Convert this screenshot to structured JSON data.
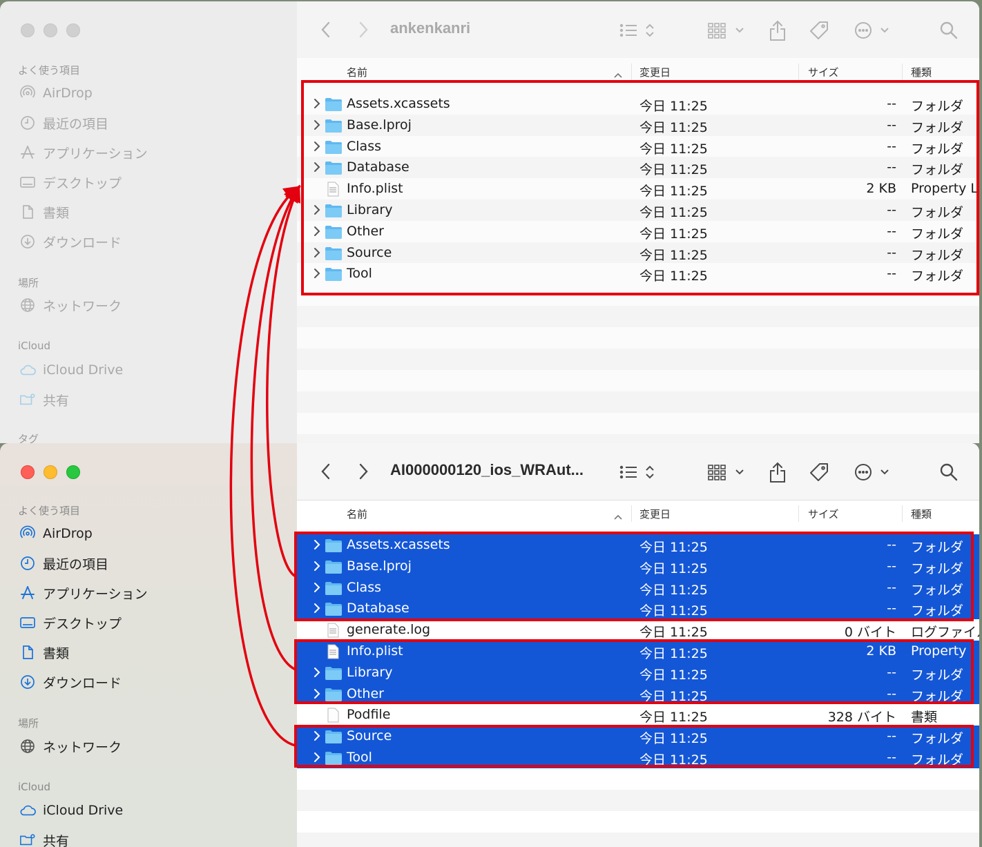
{
  "sidebar": {
    "favorites_header": "よく使う項目",
    "places_header": "場所",
    "icloud_header": "iCloud",
    "tags_header": "タグ",
    "items": [
      {
        "label": "AirDrop",
        "icon": "airdrop-icon"
      },
      {
        "label": "最近の項目",
        "icon": "clock-icon"
      },
      {
        "label": "アプリケーション",
        "icon": "applications-icon"
      },
      {
        "label": "デスクトップ",
        "icon": "desktop-icon"
      },
      {
        "label": "書類",
        "icon": "document-icon"
      },
      {
        "label": "ダウンロード",
        "icon": "download-icon"
      }
    ],
    "network": {
      "label": "ネットワーク",
      "icon": "globe-icon"
    },
    "icloud_drive": {
      "label": "iCloud Drive",
      "icon": "cloud-icon"
    },
    "shared": {
      "label": "共有",
      "icon": "shared-folder-icon"
    }
  },
  "columns": {
    "name": "名前",
    "modified": "変更日",
    "size": "サイズ",
    "kind": "種類"
  },
  "window_top": {
    "title": "ankenkanri",
    "files": [
      {
        "name": "Assets.xcassets",
        "date": "今日 11:25",
        "size": "--",
        "kind": "フォルダ",
        "type": "folder"
      },
      {
        "name": "Base.lproj",
        "date": "今日 11:25",
        "size": "--",
        "kind": "フォルダ",
        "type": "folder"
      },
      {
        "name": "Class",
        "date": "今日 11:25",
        "size": "--",
        "kind": "フォルダ",
        "type": "folder"
      },
      {
        "name": "Database",
        "date": "今日 11:25",
        "size": "--",
        "kind": "フォルダ",
        "type": "folder"
      },
      {
        "name": "Info.plist",
        "date": "今日 11:25",
        "size": "2 KB",
        "kind": "Property L",
        "type": "plist"
      },
      {
        "name": "Library",
        "date": "今日 11:25",
        "size": "--",
        "kind": "フォルダ",
        "type": "folder"
      },
      {
        "name": "Other",
        "date": "今日 11:25",
        "size": "--",
        "kind": "フォルダ",
        "type": "folder"
      },
      {
        "name": "Source",
        "date": "今日 11:25",
        "size": "--",
        "kind": "フォルダ",
        "type": "folder"
      },
      {
        "name": "Tool",
        "date": "今日 11:25",
        "size": "--",
        "kind": "フォルダ",
        "type": "folder"
      }
    ]
  },
  "window_bottom": {
    "title": "AI000000120_ios_WRAut...",
    "files": [
      {
        "name": "Assets.xcassets",
        "date": "今日 11:25",
        "size": "--",
        "kind": "フォルダ",
        "type": "folder",
        "selected": true
      },
      {
        "name": "Base.lproj",
        "date": "今日 11:25",
        "size": "--",
        "kind": "フォルダ",
        "type": "folder",
        "selected": true
      },
      {
        "name": "Class",
        "date": "今日 11:25",
        "size": "--",
        "kind": "フォルダ",
        "type": "folder",
        "selected": true
      },
      {
        "name": "Database",
        "date": "今日 11:25",
        "size": "--",
        "kind": "フォルダ",
        "type": "folder",
        "selected": true
      },
      {
        "name": "generate.log",
        "date": "今日 11:25",
        "size": "0 バイト",
        "kind": "ログファイル",
        "type": "log",
        "selected": false
      },
      {
        "name": "Info.plist",
        "date": "今日 11:25",
        "size": "2 KB",
        "kind": "Property",
        "type": "plist",
        "selected": true
      },
      {
        "name": "Library",
        "date": "今日 11:25",
        "size": "--",
        "kind": "フォルダ",
        "type": "folder",
        "selected": true
      },
      {
        "name": "Other",
        "date": "今日 11:25",
        "size": "--",
        "kind": "フォルダ",
        "type": "folder",
        "selected": true
      },
      {
        "name": "Podfile",
        "date": "今日 11:25",
        "size": "328 バイト",
        "kind": "書類",
        "type": "doc",
        "selected": false
      },
      {
        "name": "Source",
        "date": "今日 11:25",
        "size": "--",
        "kind": "フォルダ",
        "type": "folder",
        "selected": true
      },
      {
        "name": "Tool",
        "date": "今日 11:25",
        "size": "--",
        "kind": "フォルダ",
        "type": "folder",
        "selected": true
      }
    ]
  },
  "colors": {
    "selection": "#1457d6",
    "highlight": "#e3000f",
    "folder": "#5fb8f0",
    "close": "#fe5f57",
    "minimize": "#febc2e",
    "zoom": "#28c840"
  }
}
